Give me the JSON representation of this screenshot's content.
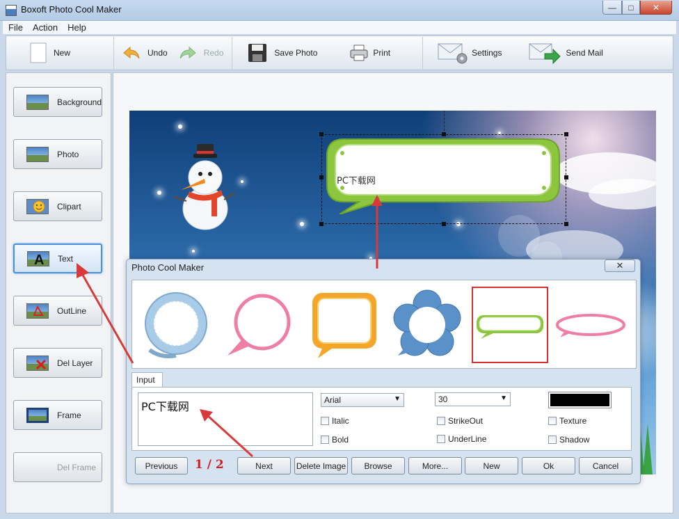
{
  "window": {
    "title": "Boxoft Photo Cool Maker",
    "min_glyph": "—",
    "max_glyph": "□",
    "close_glyph": "✕"
  },
  "menu": [
    "File",
    "Action",
    "Help"
  ],
  "toolbar": {
    "new": "New",
    "undo": "Undo",
    "redo": "Redo",
    "save_photo": "Save Photo",
    "print": "Print",
    "settings": "Settings",
    "send_mail": "Send Mail"
  },
  "sidebar": {
    "items": [
      {
        "label": "Background",
        "icon": "landscape-icon"
      },
      {
        "label": "Photo",
        "icon": "photo-icon"
      },
      {
        "label": "Clipart",
        "icon": "clipart-smiley-icon"
      },
      {
        "label": "Text",
        "icon": "text-a-icon",
        "active": true
      },
      {
        "label": "OutLine",
        "icon": "outline-icon"
      },
      {
        "label": "Del Layer",
        "icon": "delete-layer-icon"
      },
      {
        "label": "Frame",
        "icon": "frame-icon"
      },
      {
        "label": "Del Frame",
        "icon": "",
        "disabled": true
      }
    ]
  },
  "canvas": {
    "bubble_text": "PC下载网"
  },
  "dialog": {
    "title": "Photo Cool Maker",
    "close_glyph": "✕",
    "gallery": [
      {
        "name": "blue-ring-bubble"
      },
      {
        "name": "pink-speech-bubble"
      },
      {
        "name": "orange-square-bubble"
      },
      {
        "name": "blue-flower-bubble"
      },
      {
        "name": "green-rounded-bubble",
        "selected": true
      },
      {
        "name": "pink-oval-bubble"
      }
    ],
    "tab_label": "Input",
    "text_value": "PC下载网",
    "font": "Arial",
    "size": "30",
    "text_color": "#000000",
    "checkboxes": {
      "italic": "Italic",
      "bold": "Bold",
      "strikeout": "StrikeOut",
      "underline": "UnderLine",
      "texture": "Texture",
      "shadow": "Shadow"
    },
    "page_indicator": "1 / 2",
    "buttons": {
      "previous": "Previous",
      "next": "Next",
      "delete_image": "Delete Image",
      "browse": "Browse",
      "more": "More...",
      "new": "New",
      "ok": "Ok",
      "cancel": "Cancel"
    }
  },
  "colors": {
    "accent": "#4b8fd9",
    "annotation_red": "#d83a3a",
    "bubble_green": "#8cc63f"
  }
}
